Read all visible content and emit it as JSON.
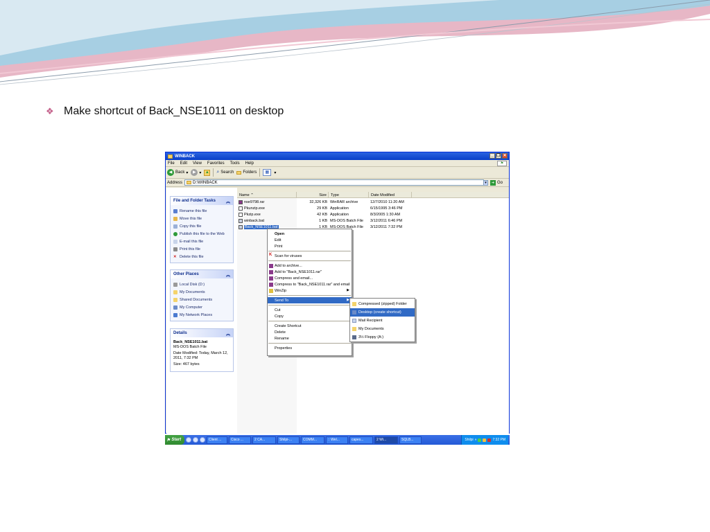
{
  "slide": {
    "bullet_glyph": "❖",
    "bullet_text": "Make shortcut of Back_NSE1011 on desktop"
  },
  "window": {
    "title": "WINBACK",
    "controls": [
      "_",
      "❐",
      "✕"
    ],
    "menu": [
      "File",
      "Edit",
      "View",
      "Favorites",
      "Tools",
      "Help"
    ],
    "toolbar": {
      "back": "Back",
      "search": "Search",
      "folders": "Folders"
    },
    "address_label": "Address",
    "address_value": "D:\\WINBACK",
    "go_label": "Go"
  },
  "left_pane": {
    "tasks": {
      "title": "File and Folder Tasks",
      "items": [
        "Rename this file",
        "Move this file",
        "Copy this file",
        "Publish this file to the Web",
        "E-mail this file",
        "Print this file",
        "Delete this file"
      ]
    },
    "places": {
      "title": "Other Places",
      "items": [
        "Local Disk (D:)",
        "My Documents",
        "Shared Documents",
        "My Computer",
        "My Network Places"
      ]
    },
    "details": {
      "title": "Details",
      "name": "Back_NSE1011.bat",
      "type": "MS-DOS Batch File",
      "modified_a": "Date Modified: Today, March 12,",
      "modified_b": "2011, 7:32 PM",
      "size": "Size: 467 bytes"
    }
  },
  "file_list": {
    "columns": [
      "Name",
      "Size",
      "Type",
      "Date Modified"
    ],
    "rows": [
      {
        "name": "nse9798.rar",
        "size": "32,326 KB",
        "type": "WinRAR archive",
        "date": "12/7/2010 11:20 AM"
      },
      {
        "name": "Pkunzip.exe",
        "size": "29 KB",
        "type": "Application",
        "date": "6/15/1995 3:46 PM"
      },
      {
        "name": "Pkzip.exe",
        "size": "42 KB",
        "type": "Application",
        "date": "8/3/2005 1:30 AM"
      },
      {
        "name": "winback.bat",
        "size": "1 KB",
        "type": "MS-DOS Batch File",
        "date": "3/12/2011 6:46 PM"
      },
      {
        "name": "Back_NSE1011.bat",
        "size": "1 KB",
        "type": "MS-DOS Batch File",
        "date": "3/12/2011 7:32 PM"
      }
    ]
  },
  "context_menu": {
    "open": "Open",
    "edit": "Edit",
    "print": "Print",
    "scan": "Scan for viruses",
    "add_archive": "Add to archive...",
    "add_rar": "Add to \"Back_NSE1011.rar\"",
    "compress_email": "Compress and email...",
    "compress_rar_email": "Compress to \"Back_NSE1011.rar\" and email",
    "winzip": "WinZip",
    "send_to": "Send To",
    "cut": "Cut",
    "copy": "Copy",
    "create_shortcut": "Create Shortcut",
    "delete": "Delete",
    "rename": "Rename",
    "properties": "Properties"
  },
  "send_to_menu": {
    "compressed": "Compressed (zipped) Folder",
    "desktop": "Desktop (create shortcut)",
    "mail": "Mail Recipient",
    "my_docs": "My Documents",
    "floppy": "3½ Floppy (A:)"
  },
  "taskbar": {
    "start": "Start",
    "tasks": [
      "Client ...",
      "Cisco ...",
      "2 CA...",
      "Shilpi-...",
      "COMM...",
      ":: Wel...",
      "capes...",
      "2 Wi...",
      "SQLB..."
    ],
    "tray_label": "Shilpi",
    "tray_chevrons": "»",
    "clock": "7:32 PM"
  },
  "colors": {
    "accent": "#316ac5",
    "title_bar": "#0a3fc8",
    "taskbar": "#245ad6",
    "start": "#2f8a2f"
  }
}
